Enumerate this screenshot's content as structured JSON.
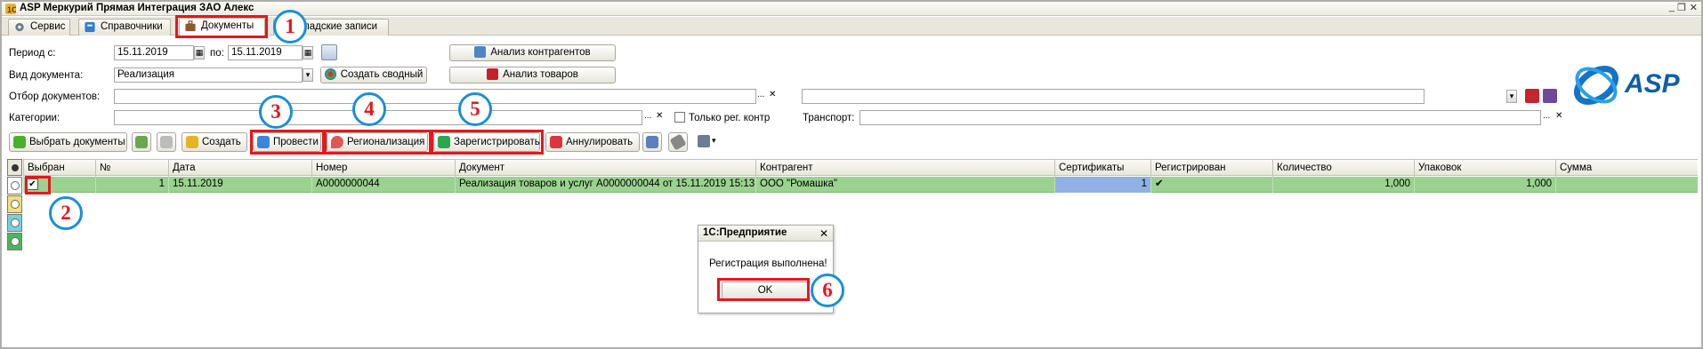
{
  "window": {
    "title": "ASP Меркурий Прямая Интеграция ЗАО Алекс",
    "controls": [
      "_",
      "❐",
      "✕"
    ]
  },
  "tabs": [
    {
      "label": "Сервис",
      "icon": "gear-icon"
    },
    {
      "label": "Справочники",
      "icon": "book-icon"
    },
    {
      "label": "Документы",
      "icon": "briefcase-icon",
      "active": true
    },
    {
      "label": "Складские записи",
      "icon": "list-icon",
      "partially_hidden_label": "ладские записи"
    }
  ],
  "filters": {
    "period_from_label": "Период с:",
    "period_from": "15.11.2019",
    "period_to_label": "по:",
    "period_to": "15.11.2019",
    "doc_type_label": "Вид документа:",
    "doc_type": "Реализация",
    "doc_filter_label": "Отбор документов:",
    "doc_filter": "",
    "categories_label": "Категории:",
    "categories": "",
    "only_reg_label": "Только рег. контр",
    "transport_label": "Транспорт:",
    "transport": "",
    "right_select": ""
  },
  "buttons": {
    "analyze_contractors": "Анализ контрагентов",
    "create_summary": "Создать сводный",
    "analyze_goods": "Анализ товаров",
    "ellipsis": "...",
    "clear": "✕"
  },
  "toolbar": {
    "select_docs": "Выбрать документы",
    "create": "Создать",
    "post": "Провести",
    "regionalize": "Регионализация",
    "register": "Зарегистрировать",
    "cancel": "Аннулировать"
  },
  "grid": {
    "columns": [
      "Выбран",
      "№",
      "Дата",
      "Номер",
      "Документ",
      "Контрагент",
      "Сертификаты",
      "Регистрирован",
      "Количество",
      "Упаковок",
      "Сумма"
    ],
    "rows": [
      {
        "selected": "✔",
        "num": "1",
        "date": "15.11.2019",
        "number": "А0000000044",
        "document": "Реализация товаров и услуг А0000000044 от 15.11.2019 15:13:...",
        "contractor": "ООО \"Ромашка\"",
        "certificates": "1",
        "registered": "✔",
        "quantity": "1,000",
        "packages": "1,000",
        "sum": ""
      }
    ]
  },
  "dialog": {
    "title": "1С:Предприятие",
    "message": "Регистрация выполнена!",
    "ok": "OK",
    "close": "✕"
  },
  "badges": [
    "1",
    "2",
    "3",
    "4",
    "5",
    "6"
  ],
  "logo": {
    "text": "ASP"
  },
  "colors": {
    "highlight_red": "#e8161d",
    "badge_blue": "#1a8fd6",
    "row_green": "#9ad38f",
    "cert_cell_blue": "#8fb1e4"
  }
}
